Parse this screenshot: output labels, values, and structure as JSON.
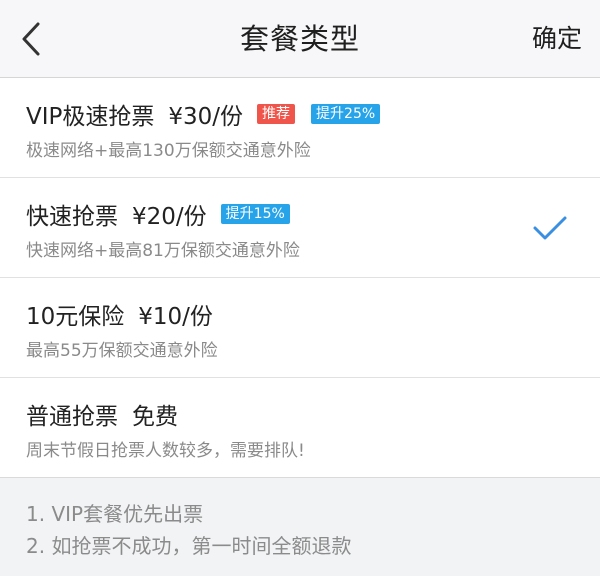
{
  "header": {
    "title": "套餐类型",
    "confirm_label": "确定",
    "back_icon": "chevron-left-icon"
  },
  "packages": [
    {
      "name": "VIP极速抢票",
      "price": "¥30/份",
      "badges": [
        {
          "text": "推荐",
          "color": "#f0554b"
        },
        {
          "text": "提升25%",
          "color": "#27a3ea"
        }
      ],
      "desc": "极速网络+最高130万保额交通意外险",
      "selected": false
    },
    {
      "name": "快速抢票",
      "price": "¥20/份",
      "badges": [
        {
          "text": "提升15%",
          "color": "#27a3ea"
        }
      ],
      "desc": "快速网络+最高81万保额交通意外险",
      "selected": true
    },
    {
      "name": "10元保险",
      "price": "¥10/份",
      "badges": [],
      "desc": "最高55万保额交通意外险",
      "selected": false
    },
    {
      "name": "普通抢票",
      "price": "免费",
      "badges": [],
      "desc": "周末节假日抢票人数较多，需要排队!",
      "selected": false
    }
  ],
  "notes": [
    "1. VIP套餐优先出票",
    "2. 如抢票不成功，第一时间全额退款"
  ],
  "colors": {
    "accent": "#27a3ea",
    "recommend": "#f0554b",
    "check": "#3a8fe0"
  }
}
